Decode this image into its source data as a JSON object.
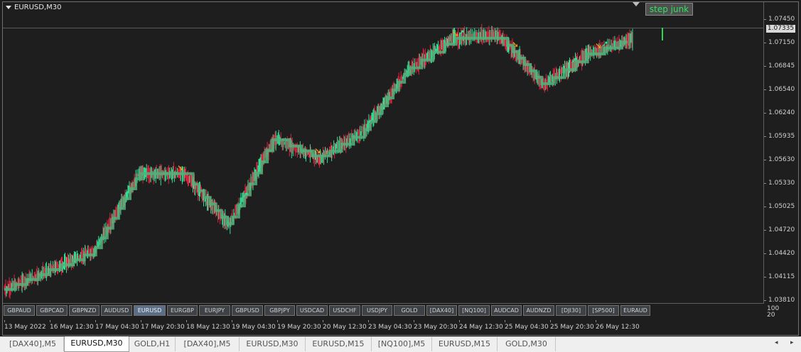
{
  "chart": {
    "title": "EURUSD,M30",
    "indicator_label": "step junk",
    "current_price": "1.07335",
    "colors": {
      "background": "#1e1e1e",
      "bull": "#2ee69a",
      "bear": "#e3213f",
      "step_line_up": "#53b07a",
      "step_line_down": "#9a5a6e",
      "arrow": "#f5a20a",
      "indicator_text": "#2fe35e"
    }
  },
  "price_axis": [
    "1.07450",
    "1.07150",
    "1.06845",
    "1.06540",
    "1.06240",
    "1.05935",
    "1.05630",
    "1.05330",
    "1.05025",
    "1.04720",
    "1.04420",
    "1.04115",
    "1.03810"
  ],
  "indicator_axis": [
    "100",
    "20"
  ],
  "symbol_buttons": [
    {
      "label": "GBPAUD",
      "active": false
    },
    {
      "label": "GBPCAD",
      "active": false
    },
    {
      "label": "GBPNZD",
      "active": false
    },
    {
      "label": "AUDUSD",
      "active": false
    },
    {
      "label": "EURUSD",
      "active": true
    },
    {
      "label": "EURGBP",
      "active": false
    },
    {
      "label": "EURJPY",
      "active": false
    },
    {
      "label": "GBPUSD",
      "active": false
    },
    {
      "label": "GBPJPY",
      "active": false
    },
    {
      "label": "USDCAD",
      "active": false
    },
    {
      "label": "USDCHF",
      "active": false
    },
    {
      "label": "USDJPY",
      "active": false
    },
    {
      "label": "GOLD",
      "active": false
    },
    {
      "label": "[DAX40]",
      "active": false
    },
    {
      "label": "[NQ100]",
      "active": false
    },
    {
      "label": "AUDCAD",
      "active": false
    },
    {
      "label": "AUDNZD",
      "active": false
    },
    {
      "label": "[DJI30]",
      "active": false
    },
    {
      "label": "[SP500]",
      "active": false
    },
    {
      "label": "EURAUD",
      "active": false
    }
  ],
  "time_axis": [
    "13 May 2022",
    "16 May 12:30",
    "17 May 04:30",
    "17 May 20:30",
    "18 May 12:30",
    "19 May 04:30",
    "19 May 20:30",
    "20 May 12:30",
    "23 May 04:30",
    "23 May 20:30",
    "24 May 12:30",
    "25 May 04:30",
    "25 May 20:30",
    "26 May 12:30"
  ],
  "tabs": [
    {
      "label": "[DAX40],M5",
      "active": false
    },
    {
      "label": "EURUSD,M30",
      "active": true
    },
    {
      "label": "GOLD,H1",
      "active": false
    },
    {
      "label": "[DAX40],M5",
      "active": false
    },
    {
      "label": "EURUSD,M30",
      "active": false
    },
    {
      "label": "EURUSD,M15",
      "active": false
    },
    {
      "label": "[NQ100],M5",
      "active": false
    },
    {
      "label": "EURUSD,M15",
      "active": false
    },
    {
      "label": "GOLD,M30",
      "active": false
    }
  ],
  "scroll": {
    "left": "◂",
    "right": "▸"
  },
  "chart_data": {
    "type": "line",
    "symbol": "EURUSD",
    "timeframe": "M30",
    "x": [
      "13 May 2022",
      "16 May 12:30",
      "17 May 04:30",
      "17 May 20:30",
      "18 May 12:30",
      "19 May 04:30",
      "19 May 20:30",
      "20 May 12:30",
      "23 May 04:30",
      "23 May 20:30",
      "24 May 12:30",
      "25 May 04:30",
      "25 May 20:30",
      "26 May 12:30"
    ],
    "ylim": [
      1.0381,
      1.0745
    ],
    "series": [
      {
        "values": [
          1.0395,
          1.042,
          1.0445,
          1.0545,
          1.0545,
          1.0478,
          1.059,
          1.0565,
          1.06,
          1.068,
          1.072,
          1.0725,
          1.066,
          1.07,
          1.072
        ]
      }
    ]
  }
}
